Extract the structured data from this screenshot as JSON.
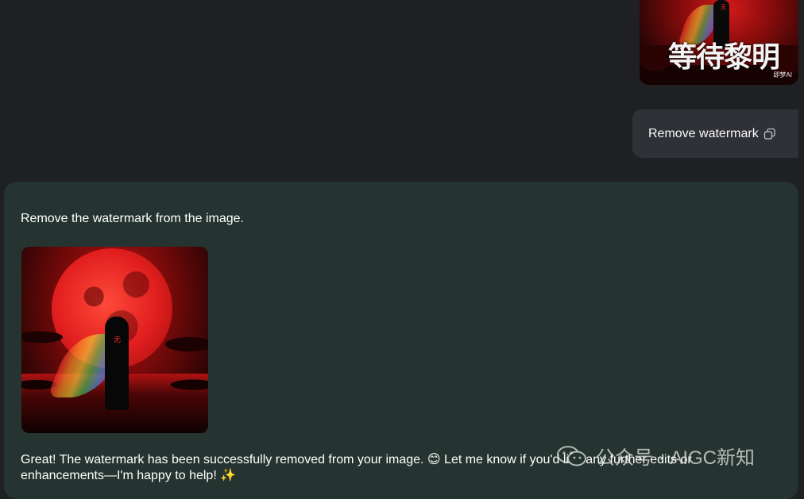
{
  "user_message": {
    "image": {
      "watermark_text": "等待黎明",
      "watermark_small": "即梦AI",
      "figure_mark": "无"
    },
    "text": "Remove watermark",
    "copy_icon": "copy-icon"
  },
  "assistant_message": {
    "intro": "Remove the watermark from the image.",
    "image": {
      "figure_mark": "无"
    },
    "followup": "Great! The watermark has been successfully removed from your image. 😊 Let me know if you'd like any further edits or enhancements—I'm happy to help! ✨"
  },
  "overlay_watermark": {
    "icon": "wechat-icon",
    "text": "公众号 · AIGC新知"
  },
  "colors": {
    "page_bg": "#1f2024",
    "user_bubble_bg": "#2f3137",
    "assistant_card_bg": "#253430",
    "text": "#ffffff"
  }
}
